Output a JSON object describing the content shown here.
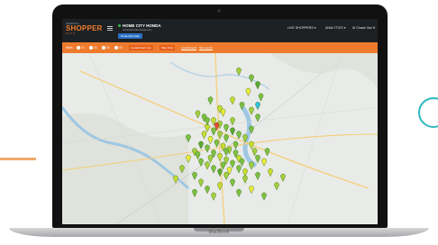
{
  "laptop": {
    "brand": "MacBook"
  },
  "app": {
    "logo": {
      "small": "ALWAYS A",
      "main": "SHOPPER",
      "sub": "CITY"
    },
    "dealer": {
      "name": "HOME CITY HONDA",
      "subtitle": "homecityhonda.shopper.city",
      "button": "Dealership Map"
    },
    "nav": {
      "live": "LIVE SHOPPERS",
      "analytics": "ANALYTICS",
      "user": "Chase Van H"
    }
  },
  "filters": {
    "label": "Miles:",
    "radios": [
      "10",
      "20",
      "30",
      "40"
    ],
    "list_btn": "Leaderboard List",
    "map_btn": "Map View",
    "link1": "Leaderboard",
    "link2": "Site search"
  },
  "map": {
    "marker_colors": [
      "#7cc142",
      "#a3cf3c",
      "#c9dd2e",
      "#ecec3a",
      "#5aa832"
    ],
    "special_colors": {
      "red": "#e8492f",
      "cyan": "#2fc2e0"
    },
    "markers": [
      [
        0.56,
        0.13,
        1
      ],
      [
        0.6,
        0.17,
        0
      ],
      [
        0.62,
        0.21,
        4
      ],
      [
        0.59,
        0.25,
        3
      ],
      [
        0.63,
        0.28,
        5
      ],
      [
        0.54,
        0.3,
        2
      ],
      [
        0.57,
        0.33,
        0
      ],
      [
        0.6,
        0.36,
        1
      ],
      [
        0.51,
        0.37,
        3
      ],
      [
        0.62,
        0.4,
        0
      ],
      [
        0.43,
        0.38,
        1
      ],
      [
        0.45,
        0.4,
        0
      ],
      [
        0.48,
        0.42,
        2
      ],
      [
        0.5,
        0.44,
        1
      ],
      [
        0.52,
        0.46,
        0
      ],
      [
        0.54,
        0.48,
        4
      ],
      [
        0.56,
        0.5,
        0
      ],
      [
        0.58,
        0.52,
        1
      ],
      [
        0.46,
        0.46,
        2
      ],
      [
        0.48,
        0.48,
        0
      ],
      [
        0.5,
        0.5,
        1
      ],
      [
        0.52,
        0.52,
        0
      ],
      [
        0.47,
        0.53,
        3
      ],
      [
        0.49,
        0.55,
        0
      ],
      [
        0.51,
        0.57,
        2
      ],
      [
        0.53,
        0.59,
        1
      ],
      [
        0.55,
        0.61,
        0
      ],
      [
        0.44,
        0.56,
        4
      ],
      [
        0.46,
        0.58,
        0
      ],
      [
        0.42,
        0.6,
        1
      ],
      [
        0.48,
        0.61,
        0
      ],
      [
        0.5,
        0.63,
        2
      ],
      [
        0.52,
        0.65,
        1
      ],
      [
        0.54,
        0.67,
        0
      ],
      [
        0.4,
        0.64,
        3
      ],
      [
        0.44,
        0.66,
        0
      ],
      [
        0.46,
        0.68,
        1
      ],
      [
        0.48,
        0.7,
        0
      ],
      [
        0.5,
        0.72,
        4
      ],
      [
        0.52,
        0.74,
        1
      ],
      [
        0.56,
        0.7,
        0
      ],
      [
        0.58,
        0.72,
        2
      ],
      [
        0.6,
        0.68,
        1
      ],
      [
        0.62,
        0.64,
        0
      ],
      [
        0.64,
        0.66,
        3
      ],
      [
        0.42,
        0.74,
        0
      ],
      [
        0.44,
        0.78,
        1
      ],
      [
        0.46,
        0.82,
        0
      ],
      [
        0.5,
        0.8,
        2
      ],
      [
        0.54,
        0.78,
        0
      ],
      [
        0.58,
        0.76,
        1
      ],
      [
        0.62,
        0.74,
        0
      ],
      [
        0.66,
        0.72,
        2
      ],
      [
        0.7,
        0.75,
        1
      ],
      [
        0.4,
        0.52,
        0
      ],
      [
        0.38,
        0.7,
        1
      ],
      [
        0.36,
        0.76,
        2
      ],
      [
        0.42,
        0.84,
        0
      ],
      [
        0.48,
        0.86,
        1
      ],
      [
        0.56,
        0.84,
        0
      ],
      [
        0.6,
        0.82,
        3
      ],
      [
        0.64,
        0.86,
        0
      ],
      [
        0.68,
        0.8,
        1
      ],
      [
        0.46,
        0.42,
        5
      ],
      [
        0.5,
        0.35,
        2
      ],
      [
        0.47,
        0.3,
        0
      ],
      [
        0.54,
        0.42,
        1
      ],
      [
        0.6,
        0.47,
        0
      ],
      [
        0.45,
        0.5,
        2
      ],
      [
        0.55,
        0.56,
        0
      ],
      [
        0.52,
        0.6,
        5
      ],
      [
        0.56,
        0.64,
        2
      ],
      [
        0.43,
        0.62,
        0
      ],
      [
        0.47,
        0.64,
        1
      ],
      [
        0.51,
        0.68,
        0
      ],
      [
        0.53,
        0.71,
        3
      ],
      [
        0.57,
        0.66,
        0
      ],
      [
        0.61,
        0.6,
        1
      ],
      [
        0.65,
        0.6,
        0
      ],
      [
        0.6,
        0.56,
        2
      ]
    ],
    "red_marker": [
      0.49,
      0.45
    ],
    "cyan_marker": [
      0.62,
      0.33
    ]
  }
}
